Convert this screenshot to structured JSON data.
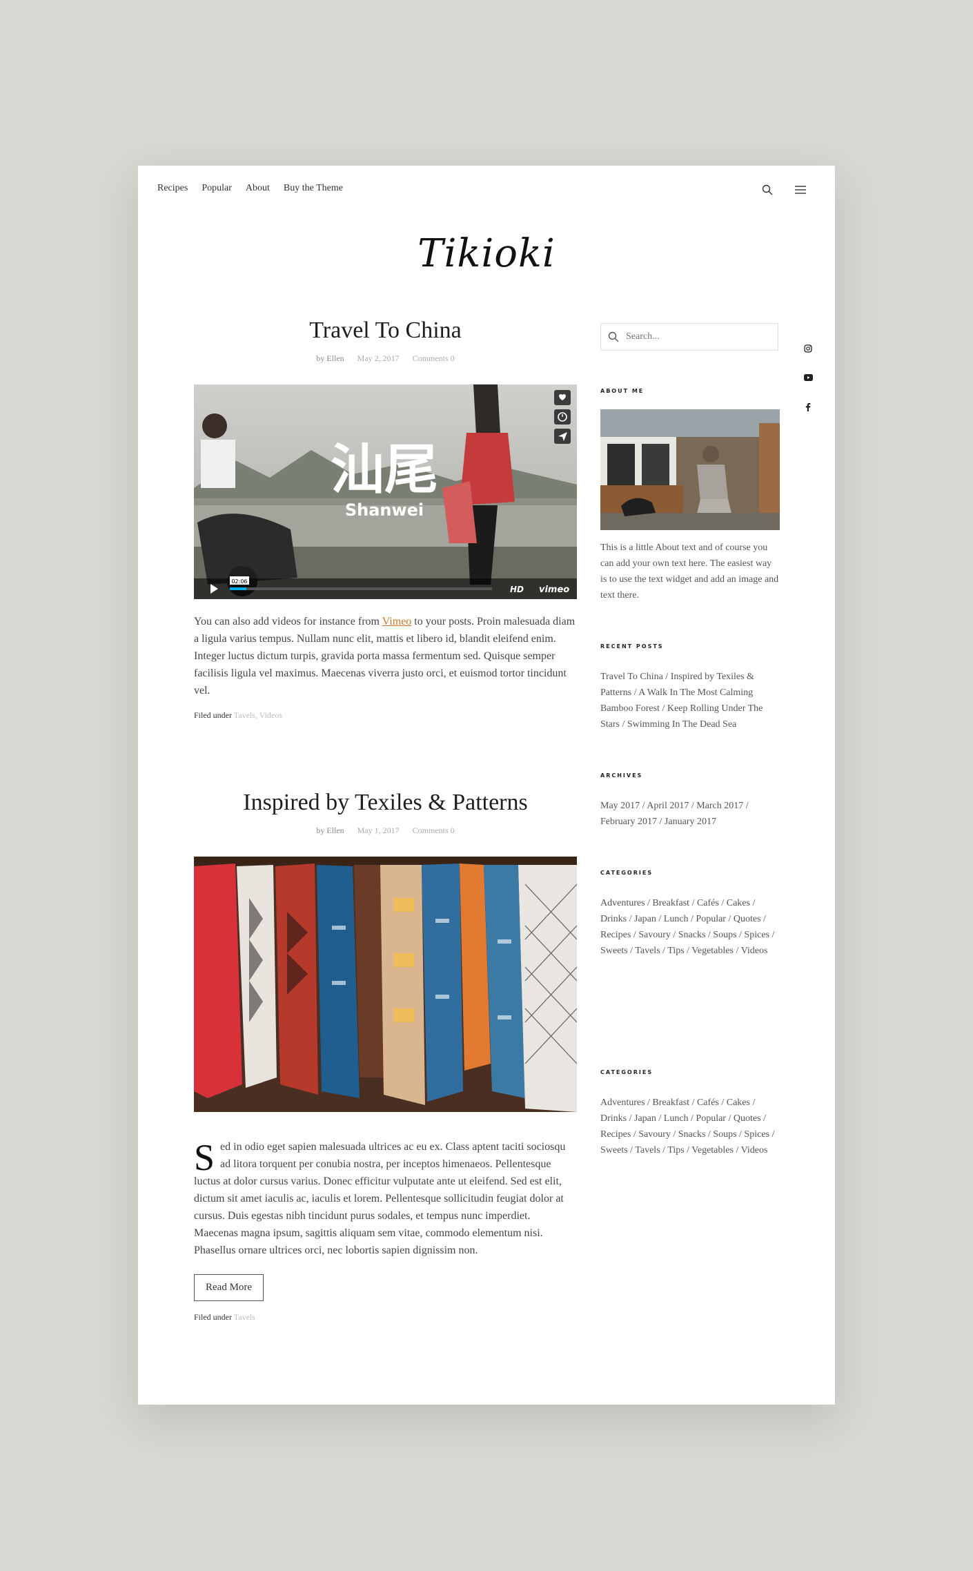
{
  "nav": {
    "items": [
      "Recipes",
      "Popular",
      "About",
      "Buy the Theme"
    ]
  },
  "logo": "Tikioki",
  "posts": [
    {
      "title": "Travel To China",
      "author": "by Ellen",
      "date": "May 2, 2017",
      "comments": "Comments 0",
      "media_caption_cn": "汕尾",
      "media_caption_en": "Shanwei",
      "video_time": "02:06",
      "video_hd": "HD",
      "video_brand": "vimeo",
      "excerpt_before": "You can also add videos for instance from ",
      "excerpt_link": "Vimeo",
      "excerpt_after": " to your posts. Proin malesuada diam a ligula varius tempus. Nullam nunc elit, mattis et libero id, blandit eleifend enim. Integer luctus dictum turpis, gravida porta massa fermentum sed. Quisque semper facilisis ligula vel maximus. Maecenas viverra justo orci, et euismod tortor tincidunt vel.",
      "filed_label": "Filed under",
      "filed_tags": "Tavels, Videos"
    },
    {
      "title": "Inspired by Texiles & Patterns",
      "author": "by Ellen",
      "date": "May 1, 2017",
      "comments": "Comments 0",
      "dropcap": "S",
      "excerpt": "ed in odio eget sapien malesuada ultrices ac eu ex. Class aptent taciti sociosqu ad litora torquent per conubia nostra, per inceptos himenaeos. Pellentesque luctus at dolor cursus varius. Donec efficitur vulputate ante ut eleifend. Sed est elit, dictum sit amet iaculis ac, iaculis et lorem. Pellentesque sollicitudin feugiat dolor at cursus. Duis egestas nibh tincidunt purus sodales, et tempus nunc imperdiet. Maecenas magna ipsum, sagittis aliquam sem vitae, commodo elementum nisi. Phasellus ornare ultrices orci, nec lobortis sapien dignissim non.",
      "read_more": "Read More",
      "filed_label": "Filed under",
      "filed_tags": "Tavels"
    }
  ],
  "sidebar": {
    "search_placeholder": "Search...",
    "about_title": "ABOUT ME",
    "about_text": "This is a little About text and of course you can add your own text here. The easiest way is to use the text widget and add an image and text there.",
    "recent_title": "RECENT POSTS",
    "recent_text": "Travel To China / Inspired by Texiles & Patterns / A Walk In The Most Calming Bamboo Forest / Keep Rolling Under The Stars / Swimming In The Dead Sea",
    "archives_title": "ARCHIVES",
    "archives_text": "May 2017 / April 2017 / March 2017 / February 2017 / January 2017",
    "categories_title": "CATEGORIES",
    "categories_text": "Adventures / Breakfast / Cafés / Cakes / Drinks / Japan / Lunch / Popular / Quotes / Recipes / Savoury / Snacks / Soups / Spices / Sweets / Tavels / Tips / Vegetables / Videos",
    "categories2_title": "CATEGORIES",
    "categories2_text": "Adventures / Breakfast / Cafés / Cakes / Drinks / Japan / Lunch / Popular / Quotes / Recipes / Savoury / Snacks / Soups / Spices / Sweets / Tavels / Tips / Vegetables / Videos"
  },
  "icons": {
    "search": "search-icon",
    "menu": "menu-icon",
    "social": [
      "instagram-icon",
      "youtube-icon",
      "facebook-icon"
    ]
  },
  "colors": {
    "background": "#d8d7d2",
    "page": "#ffffff",
    "link": "#c9772f",
    "vimeo_accent": "#00adef"
  }
}
